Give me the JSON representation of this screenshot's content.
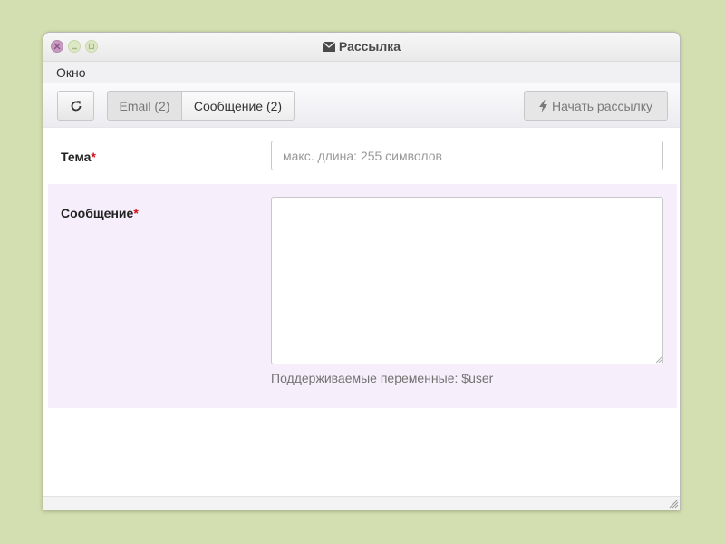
{
  "window": {
    "title": "Рассылка",
    "title_icon": "envelope-icon"
  },
  "menubar": {
    "items": [
      {
        "label": "Окно"
      }
    ]
  },
  "toolbar": {
    "refresh_icon": "refresh-icon",
    "tabs": [
      {
        "label": "Email (2)",
        "selected": false
      },
      {
        "label": "Сообщение (2)",
        "selected": true
      }
    ],
    "start_label": "Начать рассылку",
    "start_icon": "bolt-icon",
    "start_enabled": false
  },
  "form": {
    "subject": {
      "label": "Тема",
      "required_mark": "*",
      "value": "",
      "placeholder": "макс. длина: 255 символов"
    },
    "message": {
      "label": "Сообщение",
      "required_mark": "*",
      "value": "",
      "help": "Поддерживаемые переменные: $user"
    }
  },
  "colors": {
    "desktop": "#d3dfb0",
    "close_button": "#c79bc1",
    "row_highlight": "#f6eefa",
    "required": "#d0101a"
  }
}
